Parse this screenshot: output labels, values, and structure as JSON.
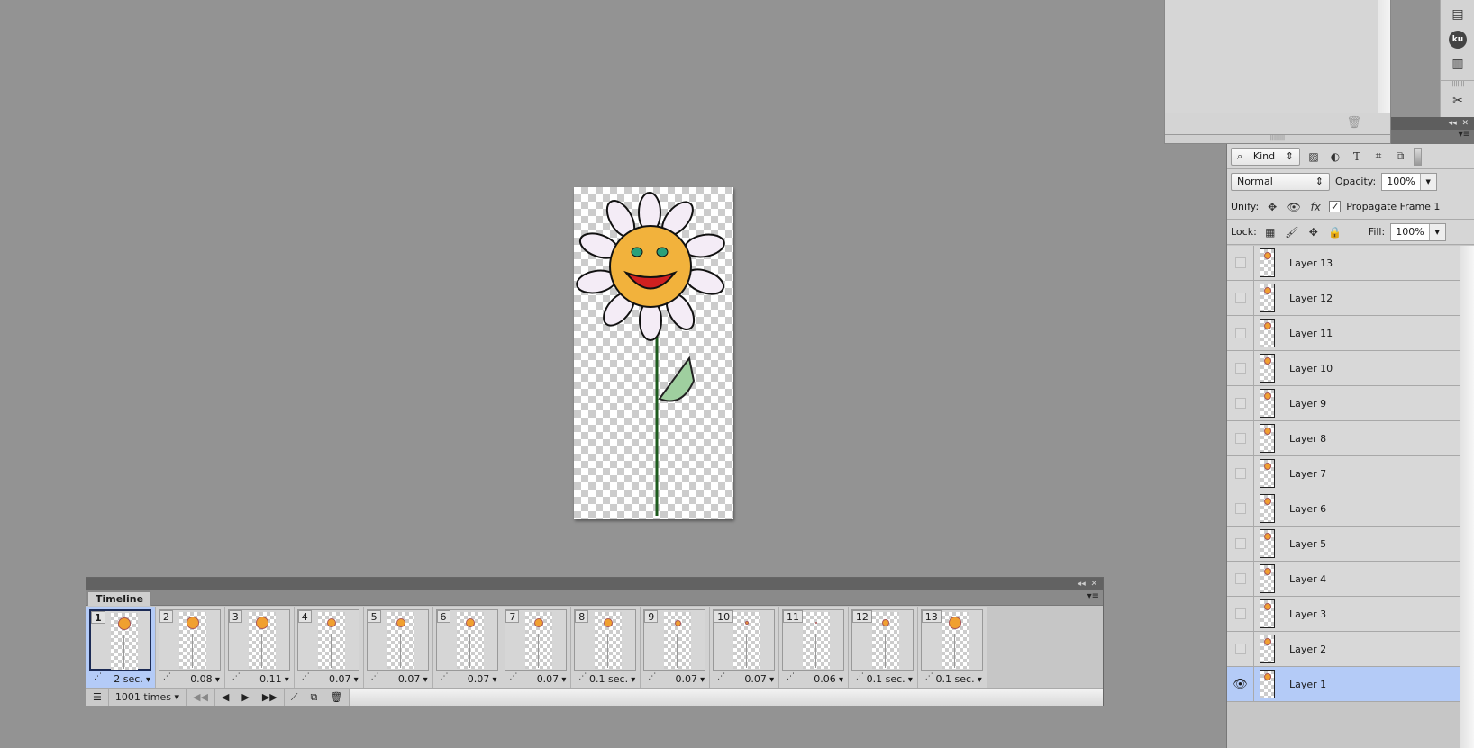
{
  "top_panel": {
    "trash_icon": "trash-icon"
  },
  "toolstrip": {
    "icons": [
      "notes-icon",
      "kuler-icon",
      "info-icon",
      "tool-presets-icon"
    ],
    "ku_label": "ku"
  },
  "layers_panel": {
    "filter": {
      "kind_label": "Kind"
    },
    "blend_mode": "Normal",
    "opacity_label": "Opacity:",
    "opacity_value": "100%",
    "unify_label": "Unify:",
    "propagate_label": "Propagate Frame 1",
    "propagate_checked": true,
    "lock_label": "Lock:",
    "fill_label": "Fill:",
    "fill_value": "100%",
    "layers": [
      {
        "name": "Layer 13",
        "visible": false
      },
      {
        "name": "Layer 12",
        "visible": false
      },
      {
        "name": "Layer 11",
        "visible": false
      },
      {
        "name": "Layer 10",
        "visible": false
      },
      {
        "name": "Layer 9",
        "visible": false
      },
      {
        "name": "Layer 8",
        "visible": false
      },
      {
        "name": "Layer 7",
        "visible": false
      },
      {
        "name": "Layer 6",
        "visible": false
      },
      {
        "name": "Layer 5",
        "visible": false
      },
      {
        "name": "Layer 4",
        "visible": false
      },
      {
        "name": "Layer 3",
        "visible": false
      },
      {
        "name": "Layer 2",
        "visible": false
      },
      {
        "name": "Layer 1",
        "visible": true,
        "selected": true
      }
    ]
  },
  "timeline": {
    "tab_label": "Timeline",
    "frames": [
      {
        "num": "1",
        "delay": "2 sec."
      },
      {
        "num": "2",
        "delay": "0.08"
      },
      {
        "num": "3",
        "delay": "0.11"
      },
      {
        "num": "4",
        "delay": "0.07"
      },
      {
        "num": "5",
        "delay": "0.07"
      },
      {
        "num": "6",
        "delay": "0.07"
      },
      {
        "num": "7",
        "delay": "0.07"
      },
      {
        "num": "8",
        "delay": "0.1 sec."
      },
      {
        "num": "9",
        "delay": "0.07"
      },
      {
        "num": "10",
        "delay": "0.07"
      },
      {
        "num": "11",
        "delay": "0.06"
      },
      {
        "num": "12",
        "delay": "0.1 sec."
      },
      {
        "num": "13",
        "delay": "0.1 sec."
      }
    ],
    "loop": "1001 times"
  },
  "colors": {
    "selection": "#b4cbf7",
    "background": "#939393"
  }
}
